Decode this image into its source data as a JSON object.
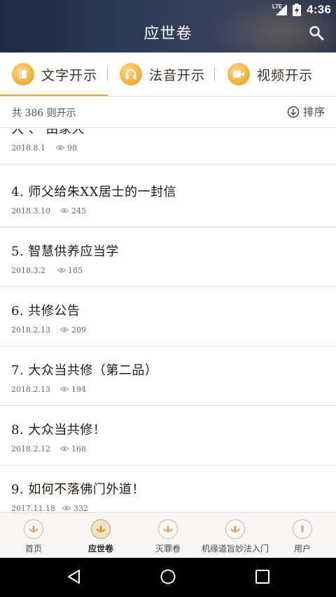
{
  "status_bar": {
    "network": "LTE",
    "time": "4:36"
  },
  "app_bar": {
    "title": "应世卷",
    "search_icon": "search-icon"
  },
  "tabs": [
    {
      "label": "文字开示",
      "icon": "book-icon",
      "active": true
    },
    {
      "label": "法音开示",
      "icon": "headphones-icon",
      "active": false
    },
    {
      "label": "视频开示",
      "icon": "video-camera-icon",
      "active": false
    }
  ],
  "count_bar": {
    "count_text": "共 386 则开示",
    "sort_label": "排序",
    "sort_icon": "arrow-down-circle-icon"
  },
  "list_items": [
    {
      "title": "大 、 由家大",
      "date": "2018.8.1",
      "views": "98"
    },
    {
      "title": "4. 师父给朱XX居士的一封信",
      "date": "2018.3.10",
      "views": "245"
    },
    {
      "title": "5. 智慧供养应当学",
      "date": "2018.3.2",
      "views": "185"
    },
    {
      "title": "6. 共修公告",
      "date": "2018.2.13",
      "views": "209"
    },
    {
      "title": "7. 大众当共修（第二品）",
      "date": "2018.2.13",
      "views": "194"
    },
    {
      "title": "8. 大众当共修！",
      "date": "2018.2.12",
      "views": "168"
    },
    {
      "title": "9. 如何不落佛门外道！",
      "date": "2017.11.18",
      "views": "332"
    }
  ],
  "bottom_nav": [
    {
      "label": "首页",
      "icon": "lotus-icon",
      "active": false
    },
    {
      "label": "应世卷",
      "icon": "lotus-icon",
      "active": true
    },
    {
      "label": "灭罪卷",
      "icon": "lotus-icon",
      "active": false
    },
    {
      "label": "机缘道旨妙法入门",
      "icon": "lotus-icon",
      "active": false
    },
    {
      "label": "用户",
      "icon": "user-icon",
      "active": false
    }
  ],
  "colors": {
    "header": "#2b3858",
    "accent": "#e4a83a",
    "text": "#231b12"
  }
}
